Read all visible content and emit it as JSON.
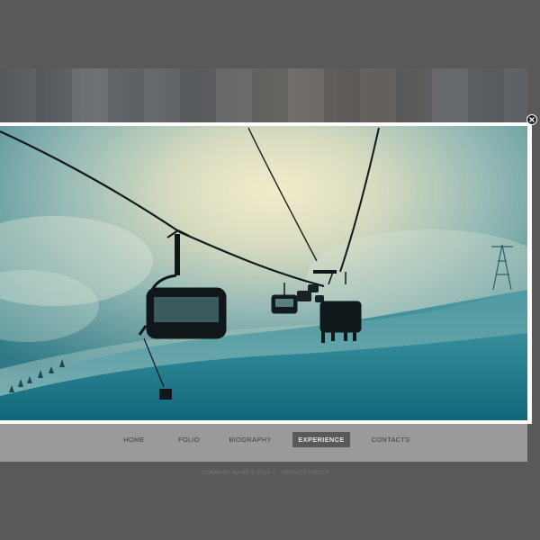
{
  "nav": {
    "items": [
      {
        "label": "HOME",
        "active": false
      },
      {
        "label": "FOLIO",
        "active": false
      },
      {
        "label": "BIOGRAPHY",
        "active": false
      },
      {
        "label": "EXPERIENCE",
        "active": true
      },
      {
        "label": "CONTACTS",
        "active": false
      }
    ]
  },
  "footer": {
    "copyright": "COMPANY NAME © 2014",
    "separator": "•",
    "privacy": "PRIVACY POLICY"
  },
  "lightbox": {
    "image_subject": "ski-chairlift-in-fog",
    "close_icon": "close-icon"
  },
  "colors": {
    "overlay": "#595959",
    "nav_background": "#9a9a9a",
    "nav_active": "#595959",
    "frame": "#ffffff"
  }
}
